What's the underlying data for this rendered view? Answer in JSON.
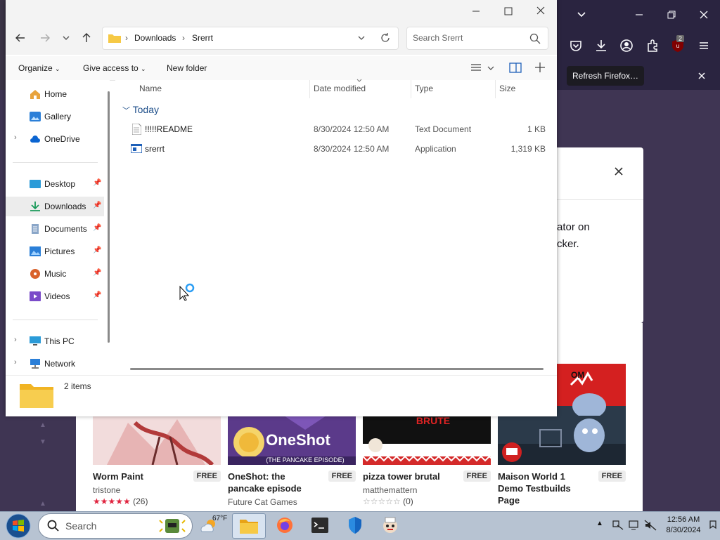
{
  "firefox": {
    "refresh_label": "Refresh Firefox…",
    "extension_badge": "2",
    "dialog_text_line1": "ator on",
    "dialog_text_line2": "cker."
  },
  "store_cards": [
    {
      "title": "Worm Paint",
      "badge": "FREE",
      "author": "tristone",
      "rating_count": "(26)",
      "stars": 5
    },
    {
      "title": "OneShot: the pancake episode",
      "badge": "FREE",
      "author": "Future Cat Games",
      "rating_count": "",
      "stars": 0
    },
    {
      "title": "pizza tower brutal",
      "badge": "FREE",
      "author": "matthemattern",
      "rating_count": "(0)",
      "stars": 0
    },
    {
      "title": "Maison World 1 Demo Testbuilds Page",
      "badge": "FREE",
      "author": "",
      "rating_count": "",
      "stars": 0
    }
  ],
  "explorer": {
    "address": {
      "segments": [
        "Downloads",
        "Srerrt"
      ]
    },
    "search": {
      "placeholder": "Search Srerrt"
    },
    "commands": {
      "organize": "Organize",
      "give_access": "Give access to",
      "new_folder": "New folder"
    },
    "nav": {
      "quick": [
        {
          "label": "Home",
          "icon": "home-icon"
        },
        {
          "label": "Gallery",
          "icon": "gallery-icon"
        },
        {
          "label": "OneDrive",
          "icon": "cloud-icon"
        }
      ],
      "pinned": [
        {
          "label": "Desktop",
          "icon": "desktop-icon"
        },
        {
          "label": "Downloads",
          "icon": "download-icon"
        },
        {
          "label": "Documents",
          "icon": "documents-icon"
        },
        {
          "label": "Pictures",
          "icon": "pictures-icon"
        },
        {
          "label": "Music",
          "icon": "music-icon"
        },
        {
          "label": "Videos",
          "icon": "videos-icon"
        }
      ],
      "devices": [
        {
          "label": "This PC",
          "icon": "pc-icon"
        },
        {
          "label": "Network",
          "icon": "network-icon"
        }
      ]
    },
    "columns": {
      "name": "Name",
      "date": "Date modified",
      "type": "Type",
      "size": "Size"
    },
    "group": "Today",
    "files": [
      {
        "name": "!!!!!README",
        "date": "8/30/2024 12:50 AM",
        "type": "Text Document",
        "size": "1 KB",
        "icon": "text-file-icon"
      },
      {
        "name": "srerrt",
        "date": "8/30/2024 12:50 AM",
        "type": "Application",
        "size": "1,319 KB",
        "icon": "application-icon"
      }
    ],
    "status": "2 items"
  },
  "taskbar": {
    "search_placeholder": "Search",
    "weather": "67°F",
    "time": "12:56 AM",
    "date": "8/30/2024"
  },
  "colors": {
    "accent": "#0067c0",
    "firefox_dark": "#2a2440",
    "star_red": "#e0243f"
  }
}
